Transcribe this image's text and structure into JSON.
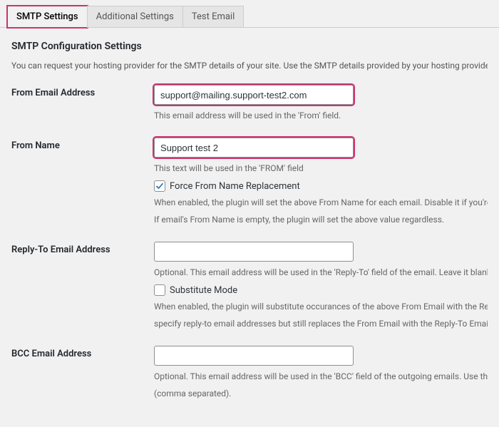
{
  "tabs": [
    {
      "label": "SMTP Settings",
      "active": true,
      "highlighted": true
    },
    {
      "label": "Additional Settings",
      "active": false,
      "highlighted": false
    },
    {
      "label": "Test Email",
      "active": false,
      "highlighted": false
    }
  ],
  "section": {
    "title": "SMTP Configuration Settings",
    "intro": "You can request your hosting provider for the SMTP details of your site. Use the SMTP details provided by your hosting provider to configure the foll"
  },
  "fields": {
    "from_email": {
      "label": "From Email Address",
      "value": "support@mailing.support-test2.com",
      "hint": "This email address will be used in the 'From' field.",
      "highlighted": true
    },
    "from_name": {
      "label": "From Name",
      "value": "Support test 2",
      "hint": "This text will be used in the 'FROM' field",
      "force_checkbox": {
        "checked": true,
        "label": "Force From Name Replacement"
      },
      "force_hint1": "When enabled, the plugin will set the above From Name for each email. Disable it if you're using conta",
      "force_hint2": "If email's From Name is empty, the plugin will set the above value regardless.",
      "highlighted": true
    },
    "reply_to": {
      "label": "Reply-To Email Address",
      "value": "",
      "hint": "Optional. This email address will be used in the 'Reply-To' field of the email. Leave it blank to use 'From",
      "sub_checkbox": {
        "checked": false,
        "label": "Substitute Mode"
      },
      "sub_hint1": "When enabled, the plugin will substitute occurances of the above From Email with the Reply-To Email a",
      "sub_hint2": "specify reply-to email addresses but still replaces the From Email with the Reply-To Email."
    },
    "bcc": {
      "label": "BCC Email Address",
      "value": "",
      "hint1": "Optional. This email address will be used in the 'BCC' field of the outgoing emails. Use this option caref",
      "hint2": "(comma separated)."
    }
  },
  "colors": {
    "highlight": "#c9356e",
    "check": "#2271b1"
  }
}
